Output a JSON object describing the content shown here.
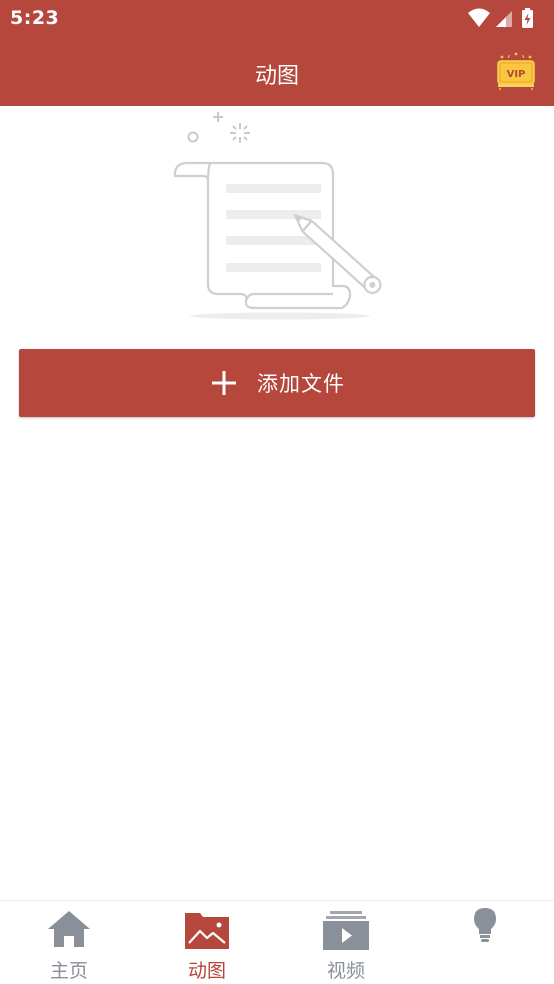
{
  "status_bar": {
    "time": "5:23",
    "icons": [
      "wifi-icon",
      "signal-icon",
      "battery-charging-icon"
    ]
  },
  "app_bar": {
    "title": "动图",
    "vip_badge_text": "VIP",
    "background_color": "#b5473c"
  },
  "main": {
    "empty_state_icon": "document-pencil-illustration",
    "add_button": {
      "icon": "plus-icon",
      "label": "添加文件"
    }
  },
  "bottom_nav": {
    "items": [
      {
        "icon": "home-icon",
        "label": "主页",
        "active": false
      },
      {
        "icon": "gif-folder-icon",
        "label": "动图",
        "active": true
      },
      {
        "icon": "video-icon",
        "label": "视频",
        "active": false
      },
      {
        "icon": "lightbulb-icon",
        "label": "",
        "active": false
      }
    ],
    "active_color": "#b5473c",
    "inactive_color": "#8a9099"
  }
}
